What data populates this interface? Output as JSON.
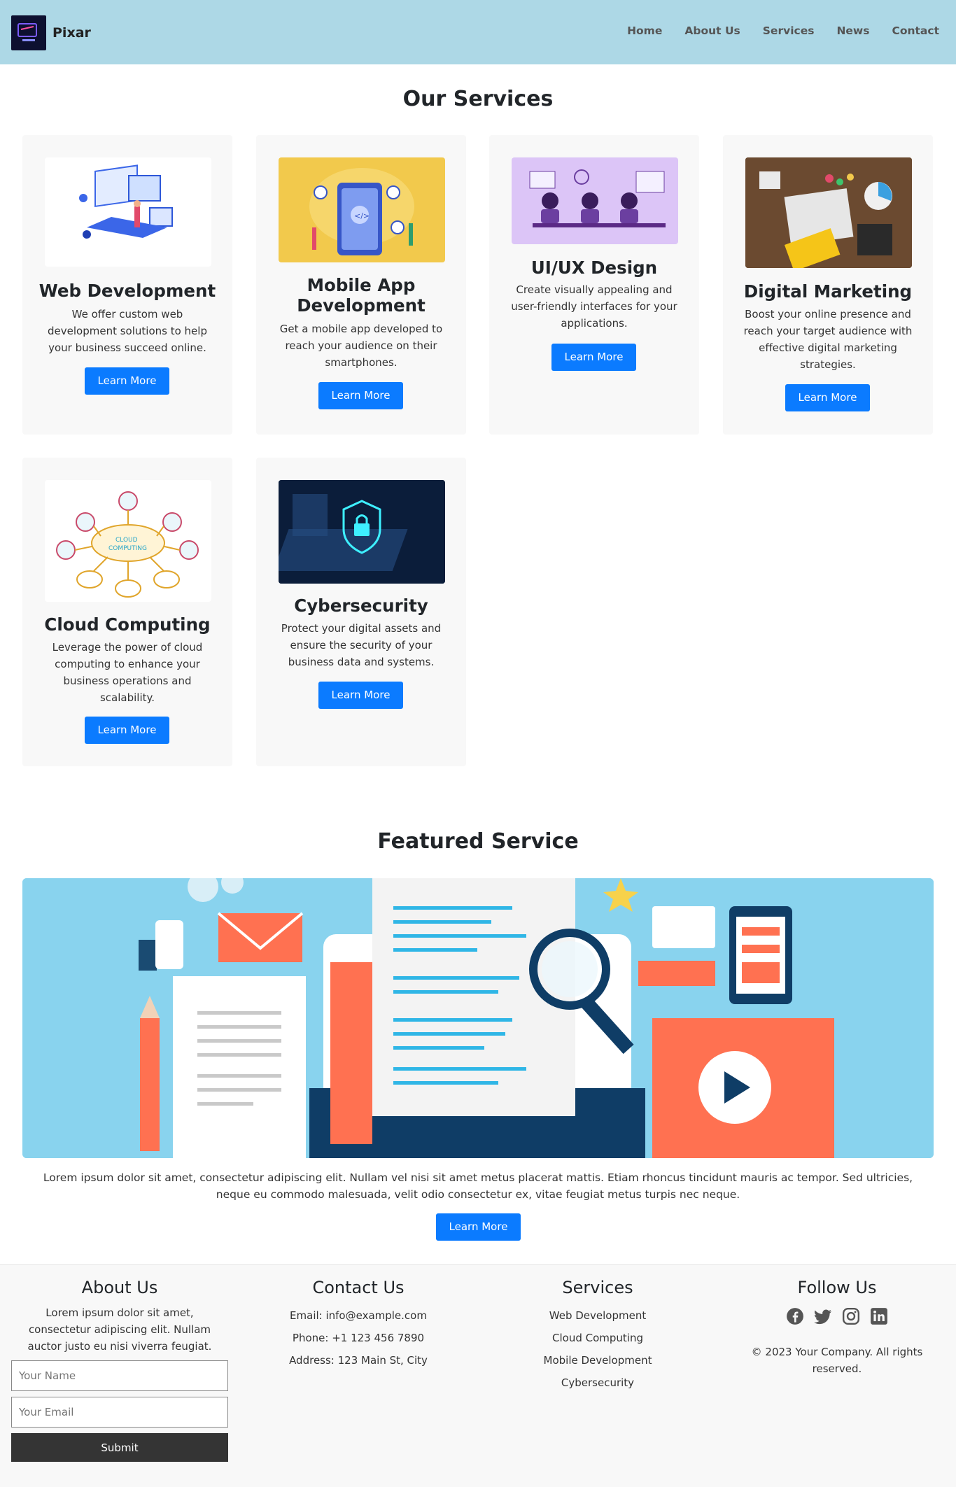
{
  "header": {
    "brand": "Pixar",
    "nav": [
      "Home",
      "About Us",
      "Services",
      "News",
      "Contact"
    ]
  },
  "services": {
    "title": "Our Services",
    "cards": [
      {
        "title": "Web Development",
        "text": "We offer custom web development solutions to help your business succeed online.",
        "button": "Learn More",
        "icon": "laptop-illustration"
      },
      {
        "title": "Mobile App Development",
        "text": "Get a mobile app developed to reach your audience on their smartphones.",
        "button": "Learn More",
        "icon": "phone-illustration"
      },
      {
        "title": "UI/UX Design",
        "text": "Create visually appealing and user-friendly interfaces for your applications.",
        "button": "Learn More",
        "icon": "designers-illustration"
      },
      {
        "title": "Digital Marketing",
        "text": "Boost your online presence and reach your target audience with effective digital marketing strategies.",
        "button": "Learn More",
        "icon": "desk-photo"
      },
      {
        "title": "Cloud Computing",
        "text": "Leverage the power of cloud computing to enhance your business operations and scalability.",
        "button": "Learn More",
        "icon": "cloud-diagram"
      },
      {
        "title": "Cybersecurity",
        "text": "Protect your digital assets and ensure the security of your business data and systems.",
        "button": "Learn More",
        "icon": "lock-photo"
      }
    ]
  },
  "featured": {
    "title": "Featured Service",
    "text": "Lorem ipsum dolor sit amet, consectetur adipiscing elit. Nullam vel nisi sit amet metus placerat mattis. Etiam rhoncus tincidunt mauris ac tempor. Sed ultricies, neque eu commodo malesuada, velit odio consectetur ex, vitae feugiat metus turpis nec neque.",
    "button": "Learn More"
  },
  "footer": {
    "about": {
      "title": "About Us",
      "text": "Lorem ipsum dolor sit amet, consectetur adipiscing elit. Nullam auctor justo eu nisi viverra feugiat.",
      "name_placeholder": "Your Name",
      "email_placeholder": "Your Email",
      "submit": "Submit"
    },
    "contact": {
      "title": "Contact Us",
      "email": "Email: info@example.com",
      "phone": "Phone: +1 123 456 7890",
      "address": "Address: 123 Main St, City"
    },
    "services": {
      "title": "Services",
      "items": [
        "Web Development",
        "Cloud Computing",
        "Mobile Development",
        "Cybersecurity"
      ]
    },
    "follow": {
      "title": "Follow Us",
      "icons": [
        "facebook-icon",
        "twitter-icon",
        "instagram-icon",
        "linkedin-icon"
      ],
      "copyright": "© 2023 Your Company. All rights reserved."
    }
  },
  "colors": {
    "header_bg": "#add8e6",
    "button": "#0b7bff",
    "card_bg": "#f8f8f8",
    "footer_bg": "#f8f8f8",
    "submit_bg": "#343434"
  }
}
